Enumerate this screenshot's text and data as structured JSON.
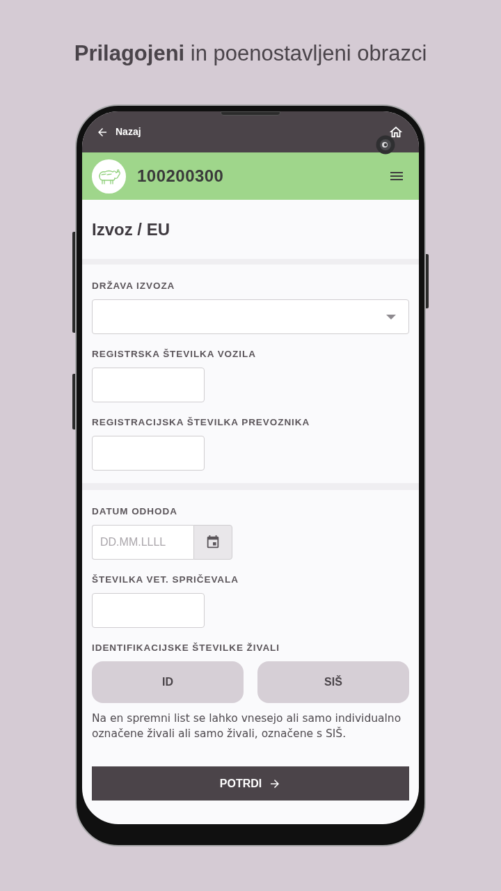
{
  "headline": "**Prilagojeni** in poenostavljeni obrazci",
  "top_bar": {
    "back_label": "Nazaj"
  },
  "header": {
    "title": "100200300"
  },
  "page_title": "Izvoz / EU",
  "sections": [
    {
      "fields": [
        {
          "kind": "select",
          "label": "DRŽAVA IZVOZA"
        },
        {
          "kind": "text",
          "label": "REGISTRSKA ŠTEVILKA VOZILA"
        },
        {
          "kind": "text",
          "label": "REGISTRACIJSKA ŠTEVILKA PREVOZNIKA"
        }
      ]
    },
    {
      "fields": [
        {
          "kind": "date",
          "label": "DATUM ODHODA",
          "placeholder": "DD.MM.LLLL"
        },
        {
          "kind": "text",
          "label": "ŠTEVILKA VET. SPRIČEVALA"
        },
        {
          "kind": "choice",
          "label": "IDENTIFIKACIJSKE ŠTEVILKE ŽIVALI",
          "options": [
            {
              "label": "ID",
              "selected": false
            },
            {
              "label": "SIŠ",
              "selected": false
            }
          ],
          "note": "Na en spremni list se lahko vnesejo ali samo individualno označene živali ali samo živali, označene s SIŠ."
        }
      ]
    }
  ],
  "submit": {
    "label": "POTRDI"
  }
}
